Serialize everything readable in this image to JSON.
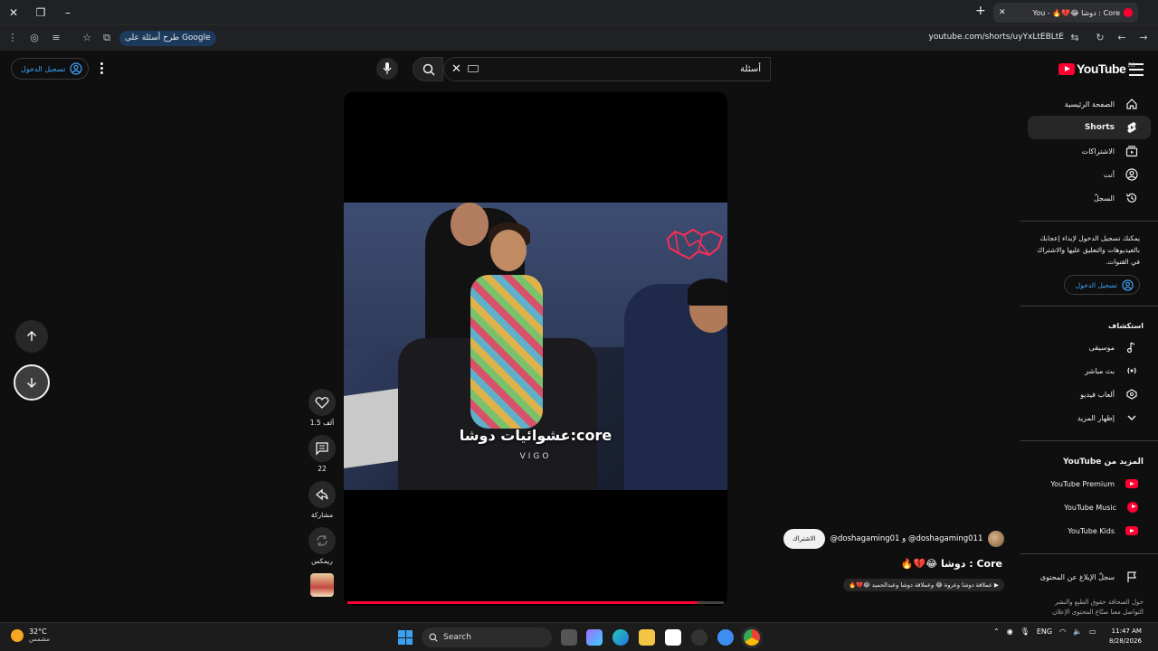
{
  "browser": {
    "tab_title": "Core : دوشا 😂💔🔥 - You",
    "google_pill": "طرح أسئلة على Google",
    "url": "youtube.com/shorts/uyYxLtEBLtE"
  },
  "header": {
    "logo_text": "YouTube",
    "country_code": "EG",
    "search_value": "أسئلة",
    "signin_label": "تسجيل الدخول"
  },
  "sidebar": {
    "items": [
      {
        "label": "الصفحة الرئيسية",
        "icon": "home-icon"
      },
      {
        "label": "Shorts",
        "icon": "shorts-icon"
      },
      {
        "label": "الاشتراكات",
        "icon": "subscriptions-icon"
      },
      {
        "label": "أنت",
        "icon": "you-icon"
      },
      {
        "label": "السجلّ",
        "icon": "history-icon"
      }
    ],
    "signin_note": "يمكنك تسجيل الدخول لإبداء إعجابك بالفيديوهات والتعليق عليها والاشتراك في القنوات.",
    "signin_button": "تسجيل الدخول",
    "explore_heading": "استكشاف",
    "explore_items": [
      {
        "label": "موسيقى",
        "icon": "music-icon"
      },
      {
        "label": "بث مباشر",
        "icon": "live-icon"
      },
      {
        "label": "ألعاب فيديو",
        "icon": "gaming-icon"
      },
      {
        "label": "إظهار المزيد",
        "icon": "chevron-down-icon"
      }
    ],
    "more_heading": "المزيد من YouTube",
    "more_items": [
      {
        "label": "YouTube Premium"
      },
      {
        "label": "YouTube Music"
      },
      {
        "label": "YouTube Kids"
      }
    ],
    "report_label": "سجلّ الإبلاغ عن المحتوى",
    "footer_line1": "حول  الصحافة  حقوق الطبع والنشر",
    "footer_line2": "التواصل معنا  صنّاع المحتوى  الإعلان"
  },
  "video": {
    "caption": "عشوائيات دوشا:core",
    "caption_sub": "VIGO",
    "progress": 0.93
  },
  "actions": {
    "like_count": "1.5 ألف",
    "comment_count": "22",
    "share_label": "مشاركة",
    "remix_label": "ريمكس"
  },
  "channel": {
    "name": "@doshagaming01 و @doshagaming011",
    "subscribe": "الاشتراك",
    "title": "Core : دوشا 😂💔🔥",
    "music": "▶ ‏عملاقة دوشا وعروة 😂 وعملاقة دوشا وعبدالحميد 😂💔🔥"
  },
  "taskbar": {
    "temp": "32°C",
    "weather": "مشمس",
    "search": "Search",
    "lang": "ENG",
    "time": "11:47 AM",
    "date": "8/28/2026"
  },
  "colors": {
    "accent": "#ff0033",
    "link": "#3ea6ff",
    "background": "#0f0f0f"
  }
}
